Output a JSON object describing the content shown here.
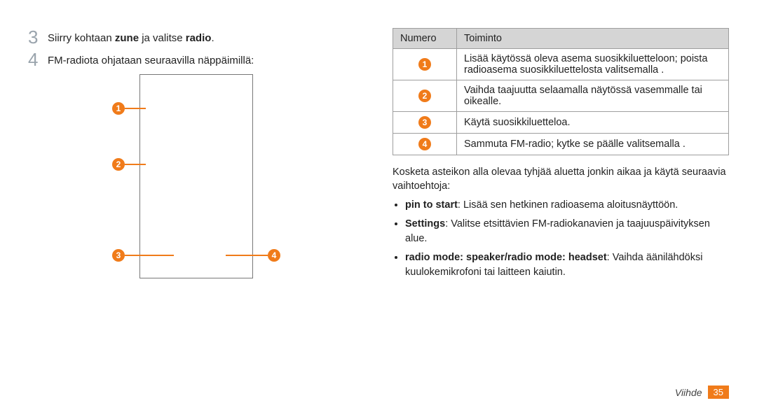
{
  "left": {
    "steps": [
      {
        "num": "3",
        "html": "Siirry kohtaan <b>zune</b> ja valitse <b>radio</b>."
      },
      {
        "num": "4",
        "html": "FM-radiota ohjataan seuraavilla näppäimillä:"
      }
    ],
    "callouts": [
      "1",
      "2",
      "3",
      "4"
    ]
  },
  "right": {
    "headers": [
      "Numero",
      "Toiminto"
    ],
    "rows": [
      {
        "n": "1",
        "t": "Lisää käytössä oleva asema suosikkiluetteloon; poista radioasema suosikkiluettelosta valitsemalla      ."
      },
      {
        "n": "2",
        "t": "Vaihda taajuutta selaamalla näytössä vasemmalle tai oikealle."
      },
      {
        "n": "3",
        "t": "Käytä suosikkiluetteloa."
      },
      {
        "n": "4",
        "t": "Sammuta FM-radio; kytke se päälle valitsemalla      ."
      }
    ],
    "para": "Kosketa asteikon alla olevaa tyhjää aluetta jonkin aikaa ja käytä seuraavia vaihtoehtoja:",
    "opts": [
      {
        "html": "<b>pin to start</b>: Lisää sen hetkinen radioasema aloitusnäyttöön."
      },
      {
        "html": "<b>Settings</b>: Valitse etsittävien FM-radiokanavien ja taajuuspäivityksen alue."
      },
      {
        "html": "<b>radio mode: speaker/radio mode: headset</b>: Vaihda äänilähdöksi kuulokemikrofoni tai laitteen kaiutin."
      }
    ]
  },
  "footer": {
    "section": "Viihde",
    "page": "35"
  }
}
